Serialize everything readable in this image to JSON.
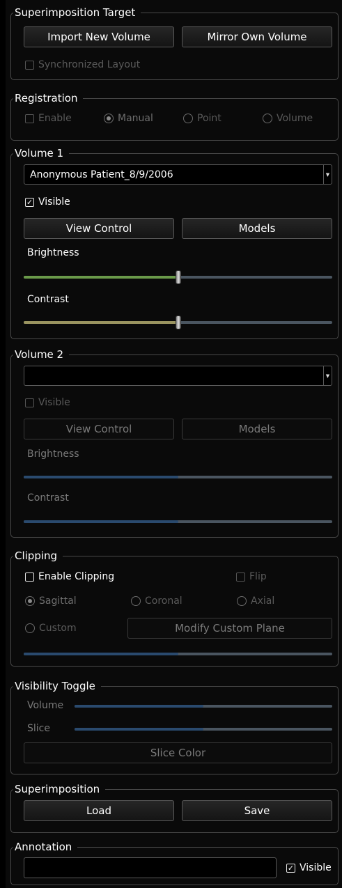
{
  "superimposition_target": {
    "title": "Superimposition Target",
    "import_button": "Import New Volume",
    "mirror_button": "Mirror Own Volume",
    "sync_layout": "Synchronized Layout"
  },
  "registration": {
    "title": "Registration",
    "enable": "Enable",
    "manual": "Manual",
    "point": "Point",
    "volume": "Volume"
  },
  "volume1": {
    "title": "Volume 1",
    "selected": "Anonymous Patient_8/9/2006",
    "visible": "Visible",
    "visible_mark": "✓",
    "view_control": "View Control",
    "models": "Models",
    "brightness": "Brightness",
    "brightness_value": 0.5,
    "brightness_color": "#6a9a4a",
    "contrast": "Contrast",
    "contrast_value": 0.5,
    "contrast_color": "#9a9460"
  },
  "volume2": {
    "title": "Volume 2",
    "selected": "",
    "visible": "Visible",
    "view_control": "View Control",
    "models": "Models",
    "brightness": "Brightness",
    "brightness_value": 0.5,
    "contrast": "Contrast",
    "contrast_value": 0.5,
    "fill_color": "#2a4a6e"
  },
  "clipping": {
    "title": "Clipping",
    "enable": "Enable Clipping",
    "flip": "Flip",
    "sagittal": "Sagittal",
    "coronal": "Coronal",
    "axial": "Axial",
    "custom": "Custom",
    "modify_plane": "Modify Custom Plane",
    "slider_value": 0.5
  },
  "visibility_toggle": {
    "title": "Visibility Toggle",
    "volume": "Volume",
    "slice": "Slice",
    "volume_value": 0.5,
    "slice_value": 0.5,
    "slice_color": "Slice Color"
  },
  "superimposition": {
    "title": "Superimposition",
    "load": "Load",
    "save": "Save"
  },
  "annotation": {
    "title": "Annotation",
    "value": "",
    "visible": "Visible",
    "visible_mark": "✓"
  }
}
